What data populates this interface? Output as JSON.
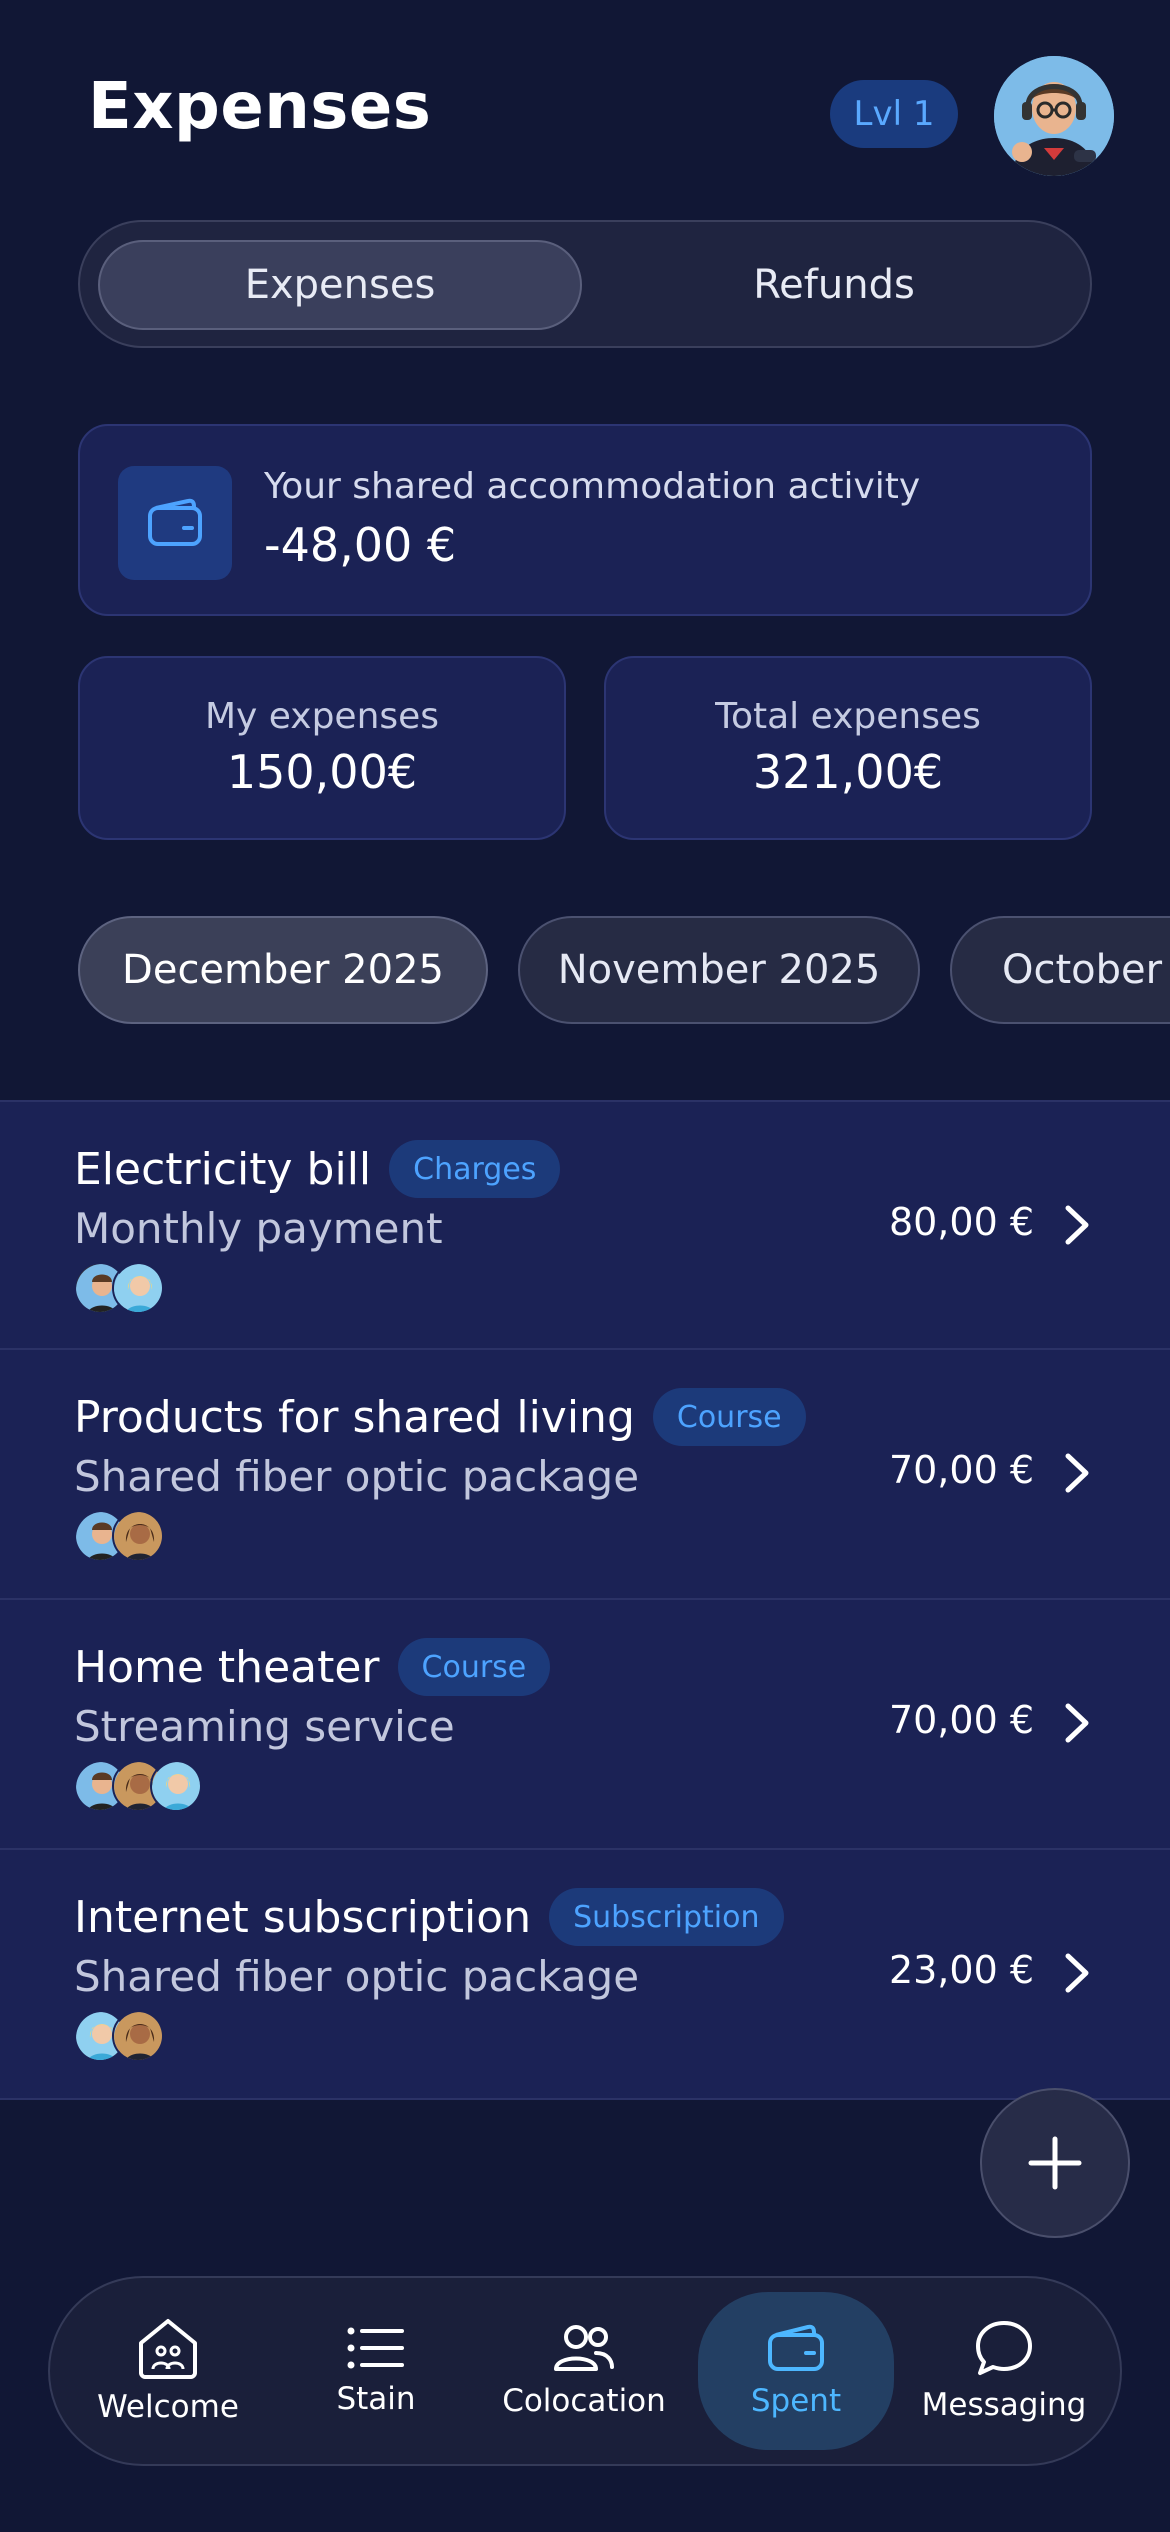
{
  "header": {
    "title": "Expenses",
    "level_badge": "Lvl 1"
  },
  "segments": {
    "expenses": "Expenses",
    "refunds": "Refunds",
    "active": "Expenses"
  },
  "activity": {
    "label": "Your shared accommodation activity",
    "amount": "-48,00 €",
    "icon": "wallet-icon"
  },
  "stats": {
    "my_label": "My expenses",
    "my_value": "150,00€",
    "total_label": "Total expenses",
    "total_value": "321,00€"
  },
  "months": [
    {
      "label": "December 2025",
      "active": true
    },
    {
      "label": "November 2025",
      "active": false
    },
    {
      "label": "October",
      "active": false
    }
  ],
  "expenses": [
    {
      "title": "Electricity bill",
      "tag": "Charges",
      "subtitle": "Monthly payment",
      "amount": "80,00 €"
    },
    {
      "title": "Products for shared living",
      "tag": "Course",
      "subtitle": "Shared fiber optic package",
      "amount": "70,00 €"
    },
    {
      "title": "Home theater",
      "tag": "Course",
      "subtitle": "Streaming service",
      "amount": "70,00 €"
    },
    {
      "title": "Internet subscription",
      "tag": "Subscription",
      "subtitle": "Shared fiber optic package",
      "amount": "23,00 €"
    }
  ],
  "nav": [
    {
      "label": "Welcome",
      "icon": "home-icon",
      "active": false
    },
    {
      "label": "Stain",
      "icon": "list-icon",
      "active": false
    },
    {
      "label": "Colocation",
      "icon": "users-icon",
      "active": false
    },
    {
      "label": "Spent",
      "icon": "wallet-icon",
      "active": true
    },
    {
      "label": "Messaging",
      "icon": "chat-icon",
      "active": false
    }
  ],
  "colors": {
    "background": "#111735",
    "card": "#1b2255",
    "accent": "#4da3ff",
    "tag_bg": "#1c3a7a"
  }
}
